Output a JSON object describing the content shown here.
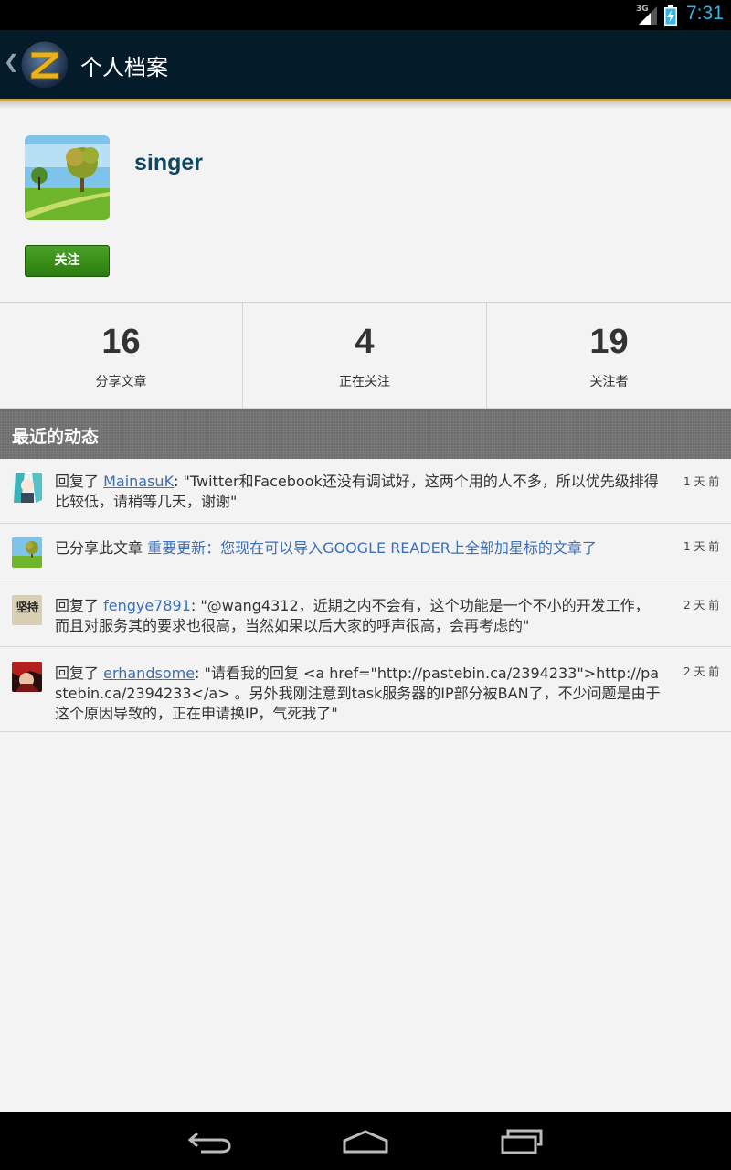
{
  "status_bar": {
    "network": "3G",
    "time": "7:31",
    "colors": {
      "time": "#33b5e5"
    }
  },
  "action_bar": {
    "title": "个人档案",
    "up_icon": "chevron-left-icon",
    "logo_icon": "app-logo-icon"
  },
  "profile": {
    "username": "singer",
    "follow_label": "关注"
  },
  "stats": [
    {
      "value": "16",
      "label": "分享文章"
    },
    {
      "value": "4",
      "label": "正在关注"
    },
    {
      "value": "19",
      "label": "关注者"
    }
  ],
  "section": {
    "title": "最近的动态"
  },
  "activities": [
    {
      "prefix": "回复了 ",
      "link": "MainasuK",
      "text": ": \"Twitter和Facebook还没有调试好，这两个用的人不多，所以优先级排得比较低，请稍等几天，谢谢\"",
      "time": "1 天 前"
    },
    {
      "prefix": "已分享此文章 ",
      "highlight": "重要更新：您现在可以导入GOOGLE READER上全部加星标的文章了",
      "time": "1 天 前"
    },
    {
      "prefix": "回复了 ",
      "link": "fengye7891",
      "text": ": \"@wang4312，近期之内不会有，这个功能是一个不小的开发工作，而且对服务其的要求也很高，当然如果以后大家的呼声很高，会再考虑的\"",
      "time": "2 天 前",
      "thumb_text": "坚持"
    },
    {
      "prefix": "回复了 ",
      "link": "erhandsome",
      "text": ": \"请看我的回复 <a href=\"http://pastebin.ca/2394233\">http://pastebin.ca/2394233</a> 。另外我刚注意到task服务器的IP部分被BAN了，不少问题是由于这个原因导致的，正在申请换IP，气死我了\"",
      "time": "2 天 前"
    }
  ],
  "nav_bar": {
    "back_icon": "back-icon",
    "home_icon": "home-icon",
    "recents_icon": "recents-icon"
  }
}
